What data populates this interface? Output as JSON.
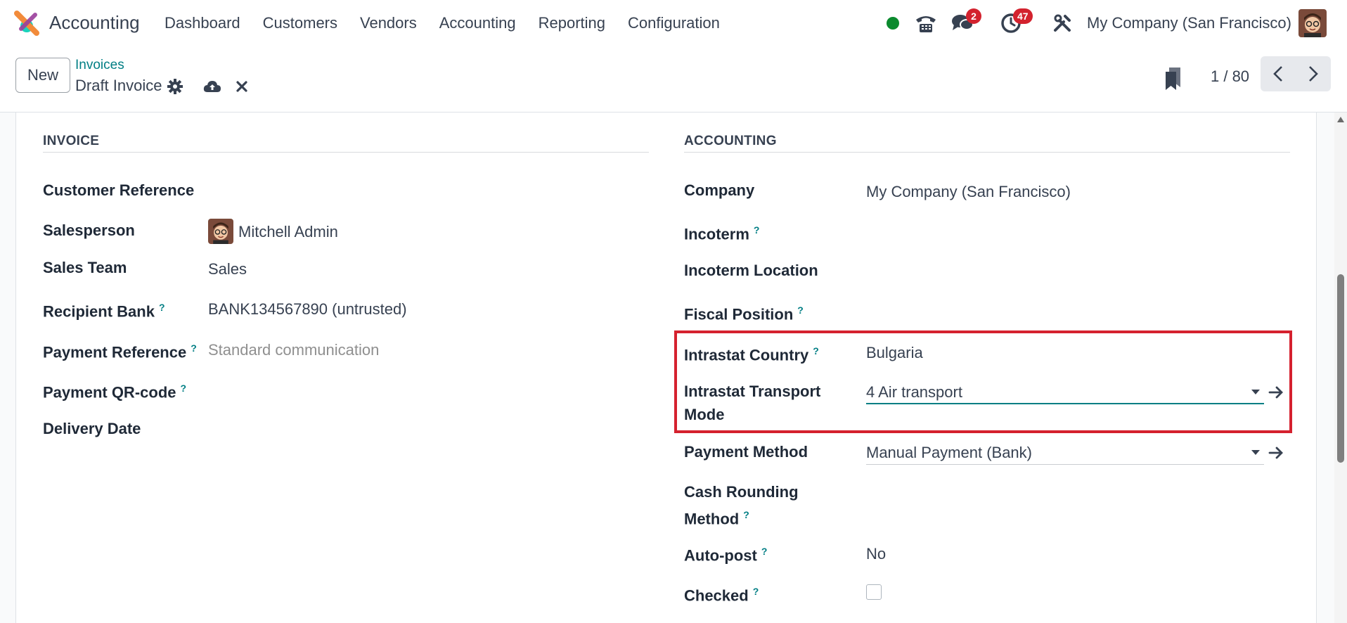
{
  "app": {
    "name": "Accounting"
  },
  "menu": [
    "Dashboard",
    "Customers",
    "Vendors",
    "Accounting",
    "Reporting",
    "Configuration"
  ],
  "systray": {
    "messages_count": "2",
    "activities_count": "47",
    "company": "My Company (San Francisco)"
  },
  "control": {
    "new_label": "New",
    "breadcrumb_parent": "Invoices",
    "breadcrumb_current": "Draft Invoice",
    "pager": "1 / 80"
  },
  "invoice_section": {
    "title": "INVOICE",
    "fields": {
      "customer_reference": {
        "label": "Customer Reference",
        "value": ""
      },
      "salesperson": {
        "label": "Salesperson",
        "value": "Mitchell Admin"
      },
      "sales_team": {
        "label": "Sales Team",
        "value": "Sales"
      },
      "recipient_bank": {
        "label": "Recipient Bank",
        "value": "BANK134567890 (untrusted)"
      },
      "payment_reference": {
        "label": "Payment Reference",
        "placeholder": "Standard communication"
      },
      "payment_qr": {
        "label": "Payment QR-code",
        "value": ""
      },
      "delivery_date": {
        "label": "Delivery Date",
        "value": ""
      }
    }
  },
  "accounting_section": {
    "title": "ACCOUNTING",
    "fields": {
      "company": {
        "label": "Company",
        "value": "My Company (San Francisco)"
      },
      "incoterm": {
        "label": "Incoterm",
        "value": ""
      },
      "incoterm_location": {
        "label": "Incoterm Location",
        "value": ""
      },
      "fiscal_position": {
        "label": "Fiscal Position",
        "value": ""
      },
      "intrastat_country": {
        "label": "Intrastat Country",
        "value": "Bulgaria"
      },
      "intrastat_transport_line1": "Intrastat Transport",
      "intrastat_transport_line2": "Mode",
      "intrastat_transport_value": "4 Air transport",
      "payment_method": {
        "label": "Payment Method",
        "value": "Manual Payment (Bank)"
      },
      "cash_rounding_line1": "Cash Rounding",
      "cash_rounding_line2": "Method",
      "auto_post": {
        "label": "Auto-post",
        "value": "No"
      },
      "checked": {
        "label": "Checked",
        "value": false
      }
    }
  },
  "help_marker": "?",
  "colors": {
    "accent": "#017e84",
    "highlight": "#d5212e",
    "badge": "#d3222e",
    "online": "#0b8a2e"
  }
}
